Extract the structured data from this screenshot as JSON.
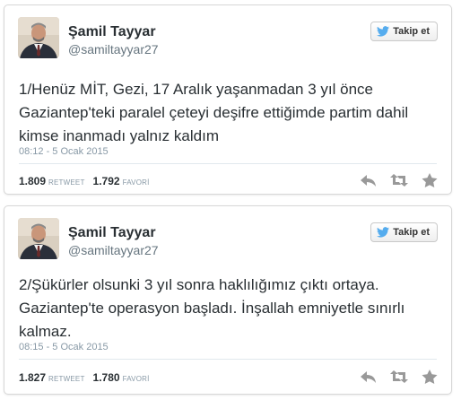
{
  "tweets": [
    {
      "author": {
        "name": "Şamil Tayyar",
        "handle": "@samiltayyar27"
      },
      "follow_label": "Takip et",
      "text": "1/Henüz MİT, Gezi, 17 Aralık yaşanmadan 3 yıl önce Gaziantep'teki paralel çeteyi deşifre ettiğimde partim dahil kimse inanmadı yalnız kaldım",
      "timestamp": "08:12 - 5 Ocak 2015",
      "retweets": "1.809",
      "retweets_label": "RETWEET",
      "favorites": "1.792",
      "favorites_label": "FAVORİ"
    },
    {
      "author": {
        "name": "Şamil Tayyar",
        "handle": "@samiltayyar27"
      },
      "follow_label": "Takip et",
      "text": "2/Şükürler olsunki 3 yıl sonra haklılığımız çıktı ortaya. Gaziantep'te operasyon başladı. İnşallah emniyetle sınırlı kalmaz.",
      "timestamp": "08:15 - 5 Ocak 2015",
      "retweets": "1.827",
      "retweets_label": "RETWEET",
      "favorites": "1.780",
      "favorites_label": "FAVORİ"
    }
  ],
  "colors": {
    "twitter_blue": "#55acee",
    "text": "#292f33",
    "muted": "#8899a6",
    "icon": "#999999"
  },
  "icons": [
    "bird-icon",
    "reply-icon",
    "retweet-icon",
    "favorite-icon"
  ]
}
